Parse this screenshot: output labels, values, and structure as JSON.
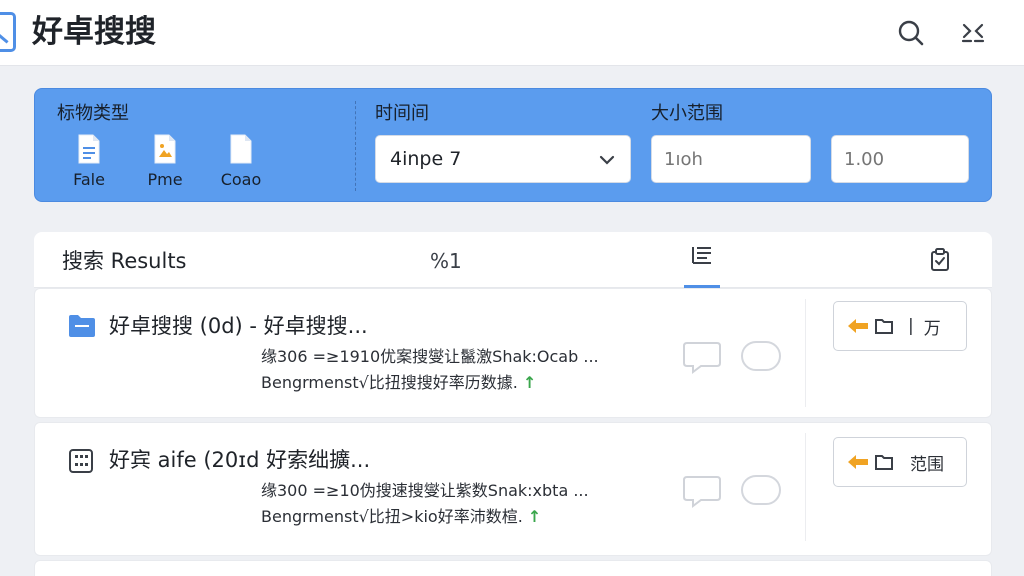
{
  "app": {
    "title": "好卓搜搜"
  },
  "header": {
    "search_icon": "search-icon",
    "collapse_icon": "collapse-icon"
  },
  "filters": {
    "type_label": "标物类型",
    "types": [
      {
        "label": "Fale",
        "icon": "file-icon"
      },
      {
        "label": "Pme",
        "icon": "image-file-icon"
      },
      {
        "label": "Coao",
        "icon": "code-file-icon"
      }
    ],
    "time_label": "时间间",
    "time_value": "4inpe 7",
    "size_label": "大小范围",
    "size_min": "1ıoh",
    "size_max": "1.00"
  },
  "results": {
    "title": "搜索 Results",
    "count": "%1",
    "items": [
      {
        "title": "好卓搜搜 (0d) - 好卓搜搜...",
        "line1": "缘306 =≥1910优案搜燮让鬣激Shak:Ocab ...",
        "line2": "Bengrmenst√比扭搜搜好率历数據.",
        "arrow": "↑",
        "action_label": "万",
        "action_sep": "|"
      },
      {
        "title": "好宾 aife  (20ɪd  好索绌擴...",
        "line1": "缘300 =≥10伪搜速搜燮让紫数Snak:xbta ...",
        "line2": "Bengrmenst√比扭>kio好率沛数楦.",
        "arrow": "↑",
        "action_label": "范围",
        "action_sep": ""
      }
    ]
  },
  "colors": {
    "accent": "#4f8fe6",
    "panel": "#5b9cee",
    "folder": "#4f8fe6",
    "action_arrow": "#f0a323"
  }
}
